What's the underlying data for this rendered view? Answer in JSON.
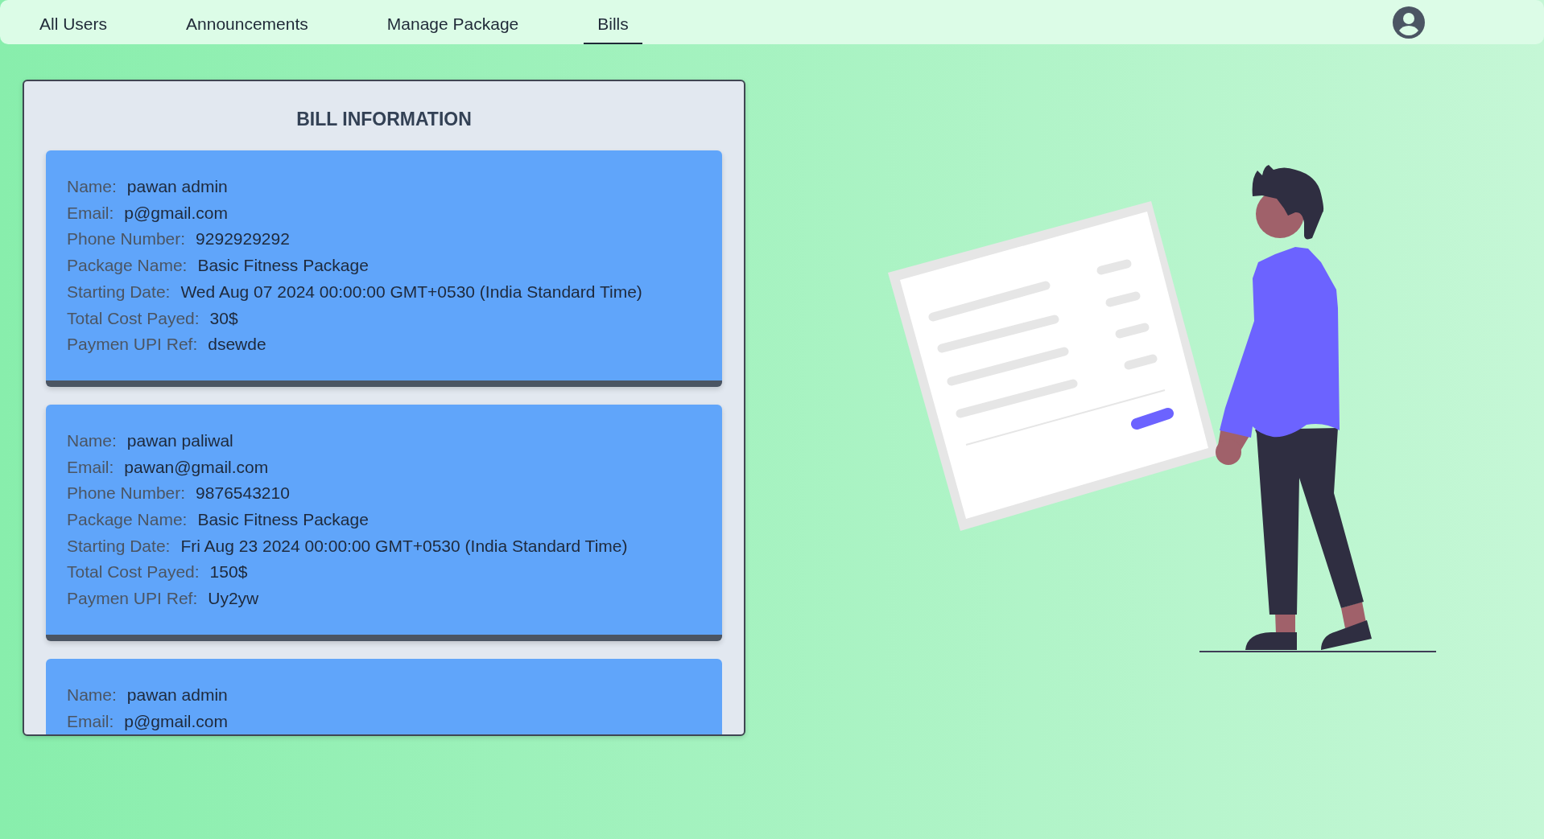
{
  "nav": {
    "tabs": [
      {
        "label": "All Users",
        "selected": false
      },
      {
        "label": "Announcements",
        "selected": false
      },
      {
        "label": "Manage Package",
        "selected": false
      },
      {
        "label": "Bills",
        "selected": true
      }
    ]
  },
  "panel": {
    "title": "BILL INFORMATION",
    "bills": [
      {
        "cut_off": false,
        "fields": [
          {
            "label": "Name:",
            "value": "pawan admin"
          },
          {
            "label": "Email:",
            "value": "p@gmail.com"
          },
          {
            "label": "Phone Number:",
            "value": "9292929292"
          },
          {
            "label": "Package Name:",
            "value": "Basic Fitness Package"
          },
          {
            "label": "Starting Date:",
            "value": "Wed Aug 07 2024 00:00:00 GMT+0530 (India Standard Time)"
          },
          {
            "label": "Total Cost Payed:",
            "value": "30$"
          },
          {
            "label": "Paymen UPI Ref:",
            "value": "dsewde"
          }
        ]
      },
      {
        "cut_off": false,
        "fields": [
          {
            "label": "Name:",
            "value": "pawan paliwal"
          },
          {
            "label": "Email:",
            "value": "pawan@gmail.com"
          },
          {
            "label": "Phone Number:",
            "value": "9876543210"
          },
          {
            "label": "Package Name:",
            "value": "Basic Fitness Package"
          },
          {
            "label": "Starting Date:",
            "value": "Fri Aug 23 2024 00:00:00 GMT+0530 (India Standard Time)"
          },
          {
            "label": "Total Cost Payed:",
            "value": "150$"
          },
          {
            "label": "Paymen UPI Ref:",
            "value": "Uy2yw"
          }
        ]
      },
      {
        "cut_off": true,
        "fields": [
          {
            "label": "Name:",
            "value": "pawan admin"
          },
          {
            "label": "Email:",
            "value": "p@gmail.com"
          }
        ]
      }
    ]
  }
}
